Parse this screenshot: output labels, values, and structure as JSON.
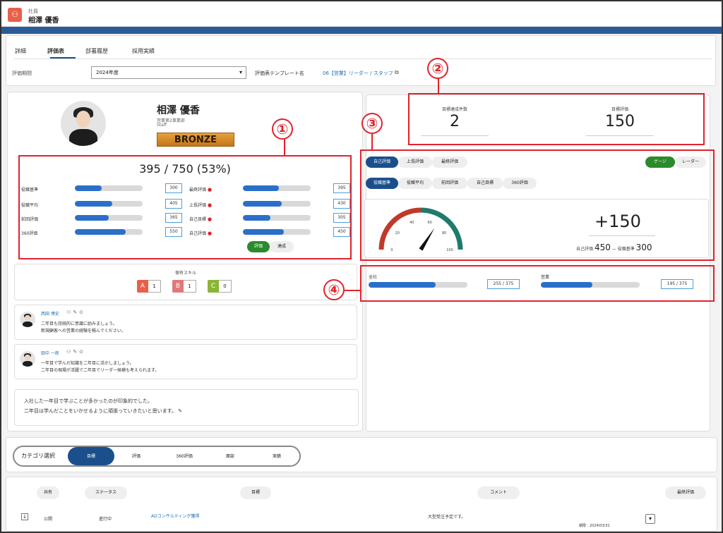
{
  "header": {
    "small_label": "社員",
    "employee_name": "相澤 優香",
    "app_icon": "people-icon"
  },
  "tabs": [
    {
      "label": "詳細"
    },
    {
      "label": "評価表"
    },
    {
      "label": "部署履歴"
    },
    {
      "label": "採用実績"
    }
  ],
  "period": {
    "label": "評価期間",
    "value": "2024年度"
  },
  "template": {
    "label": "評価表テンプレート名",
    "link": "06【営業】リーダー / スタッフ"
  },
  "profile": {
    "name": "相澤 優香",
    "department": "営業第2事業部",
    "role": "Staff",
    "rank": "BRONZE"
  },
  "score": {
    "title": "395 / 750 (53%)",
    "left_metrics": [
      {
        "label": "役職基準",
        "value": "300",
        "fraction": 0.4
      },
      {
        "label": "役職平均",
        "value": "405",
        "fraction": 0.55
      },
      {
        "label": "前回評価",
        "value": "365",
        "fraction": 0.5
      },
      {
        "label": "360評価",
        "value": "550",
        "fraction": 0.75
      }
    ],
    "right_metrics": [
      {
        "label": "最終評価",
        "value": "395",
        "fraction": 0.53
      },
      {
        "label": "上長評価",
        "value": "430",
        "fraction": 0.57
      },
      {
        "label": "自己目標",
        "value": "305",
        "fraction": 0.41
      },
      {
        "label": "自己評価",
        "value": "450",
        "fraction": 0.6
      }
    ],
    "toggle": [
      "評価",
      "達成"
    ]
  },
  "skills": {
    "title": "保有スキル",
    "items": [
      {
        "grade": "A",
        "count": "1",
        "color": "#e8604a"
      },
      {
        "grade": "B",
        "count": "1",
        "color": "#e07a7a"
      },
      {
        "grade": "C",
        "count": "0",
        "color": "#8ab436"
      }
    ]
  },
  "comments": [
    {
      "name": "西田 博史",
      "line1": "二年目も持続的に意識に励みましょう。",
      "line2": "新規顧客への営業の経験を積んでください。"
    },
    {
      "name": "田中 一郎",
      "line1": "一年目で学んだ知識を二年目に活かしましょう。",
      "line2": "二年目の現場が活躍で二年目でリーダー候補も考えられます。"
    }
  ],
  "self_comment": {
    "line1": "入社した一年目で学ぶことが多かったのが印象的でした。",
    "line2": "二年目は学んだことをいかせるように頑張っていきたいと思います。"
  },
  "summary": {
    "goal_count_label": "目標達成件数",
    "goal_count": "2",
    "goal_eval_label": "目標評価",
    "goal_eval": "150"
  },
  "gauge": {
    "tabs_row1": [
      "自己評価",
      "上長評価",
      "最終評価"
    ],
    "view_toggle": [
      "ゲージ",
      "レーダー"
    ],
    "tabs_row2": [
      "役職基準",
      "役職平均",
      "前回評価",
      "自己目標",
      "360評価"
    ],
    "ticks": [
      "0",
      "20",
      "40",
      "60",
      "80",
      "100"
    ],
    "needle_value": 68,
    "diff": "+150",
    "self_label": "自己評価",
    "self_value": "450",
    "role_label": "役職基準",
    "role_value": "300",
    "dash": "—"
  },
  "org": [
    {
      "label": "全社",
      "value": "255 / 375",
      "fraction": 0.68
    },
    {
      "label": "営業",
      "value": "195 / 375",
      "fraction": 0.52
    }
  ],
  "callouts": [
    "①",
    "②",
    "③",
    "④"
  ],
  "category": {
    "label": "カテゴリ選択",
    "items": [
      "目標",
      "評価",
      "360評価",
      "面談",
      "実績"
    ]
  },
  "table": {
    "headers": [
      "共有",
      "ステータス",
      "目標",
      "コメント",
      "最終評価"
    ],
    "row": {
      "share": "公開",
      "status": "進行中",
      "goal": "ADコンサルティング獲得",
      "comment": "大型受注予定です。",
      "meta": "期限 : 2024/03/31"
    }
  }
}
